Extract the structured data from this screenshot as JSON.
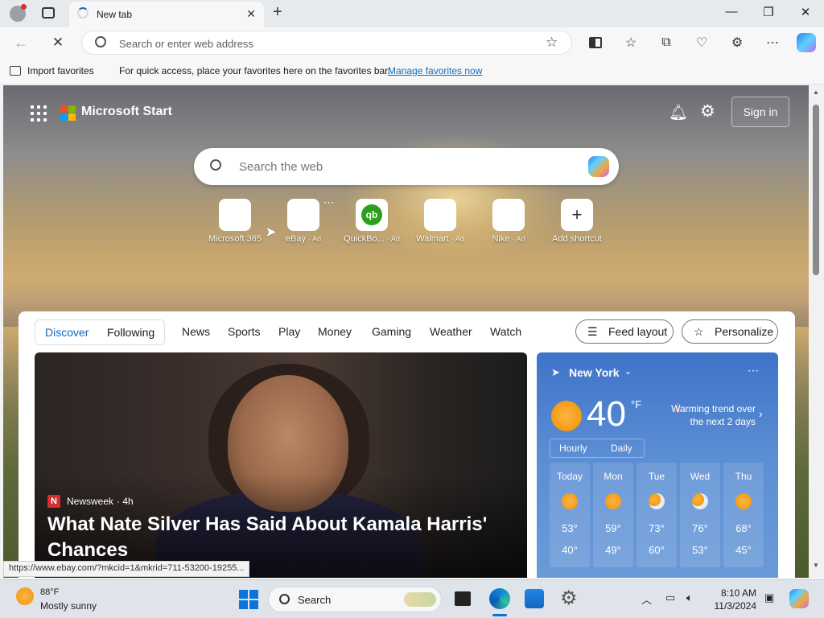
{
  "browser": {
    "tab_title": "New tab",
    "address_placeholder": "Search or enter web address",
    "favorites_bar": {
      "import_label": "Import favorites",
      "message": "For quick access, place your favorites here on the favorites bar.",
      "manage_link": "Manage favorites now"
    },
    "status_url": "https://www.ebay.com/?mkcid=1&mkrid=711-53200-19255..."
  },
  "start": {
    "brand": "Microsoft Start",
    "sign_in": "Sign in",
    "search_placeholder": "Search the web",
    "shortcuts": [
      {
        "label": "Microsoft 365",
        "ad": ""
      },
      {
        "label": "eBay",
        "ad": "· Ad"
      },
      {
        "label": "QuickBo...",
        "ad": "· Ad"
      },
      {
        "label": "Walmart",
        "ad": "· Ad"
      },
      {
        "label": "Nike",
        "ad": "· Ad"
      },
      {
        "label": "Add shortcut",
        "ad": ""
      }
    ]
  },
  "feed": {
    "segments": [
      "Discover",
      "Following"
    ],
    "nav": [
      "News",
      "Sports",
      "Play",
      "Money",
      "Gaming",
      "Weather",
      "Watch"
    ],
    "feed_layout": "Feed layout",
    "personalize": "Personalize",
    "hero": {
      "source": "Newsweek",
      "age": "· 4h",
      "headline": "What Nate Silver Has Said About Kamala Harris' Chances"
    },
    "weather": {
      "city": "New York",
      "temp": "40",
      "unit": "°F",
      "trend": "Warming trend over the next 2 days",
      "tabs": [
        "Hourly",
        "Daily"
      ],
      "days": [
        {
          "day": "Today",
          "hi": "53°",
          "lo": "40°",
          "icon": "sunny"
        },
        {
          "day": "Mon",
          "hi": "59°",
          "lo": "49°",
          "icon": "sunny"
        },
        {
          "day": "Tue",
          "hi": "73°",
          "lo": "60°",
          "icon": "partly-cloudy"
        },
        {
          "day": "Wed",
          "hi": "76°",
          "lo": "53°",
          "icon": "partly-cloudy"
        },
        {
          "day": "Thu",
          "hi": "68°",
          "lo": "45°",
          "icon": "sunny"
        }
      ]
    }
  },
  "taskbar": {
    "weather_temp": "88°F",
    "weather_cond": "Mostly sunny",
    "search_label": "Search",
    "time": "8:10 AM",
    "date": "11/3/2024"
  },
  "colors": {
    "accent": "#0f6cbd",
    "weather_card": "#4a7fcd"
  }
}
